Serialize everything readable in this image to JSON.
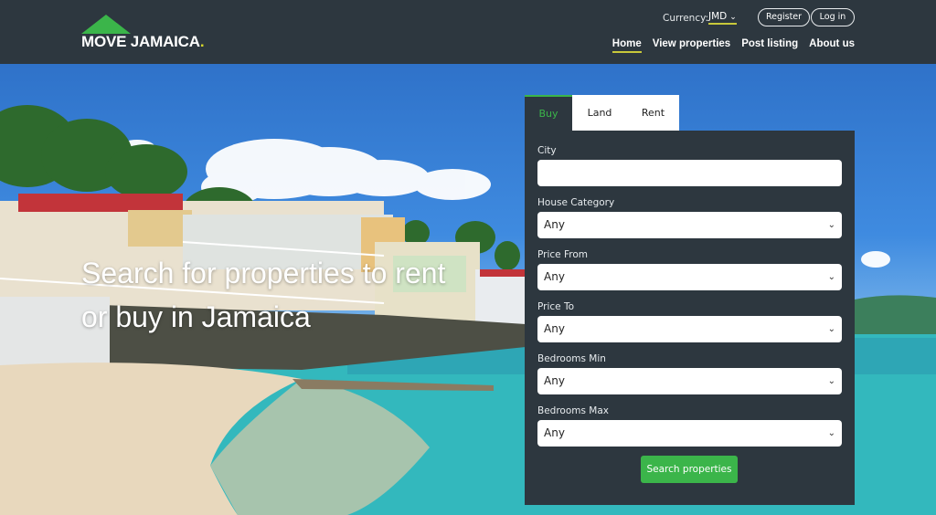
{
  "brand": {
    "name": "MOVE JAMAICA",
    "dot": "."
  },
  "header": {
    "currency_label": "Currency:",
    "currency_value": "JMD",
    "register_label": "Register",
    "login_label": "Log in",
    "nav": [
      {
        "label": "Home",
        "active": true
      },
      {
        "label": "View properties"
      },
      {
        "label": "Post listing"
      },
      {
        "label": "About us"
      }
    ]
  },
  "hero": {
    "heading": "Search for properties to rent or buy in Jamaica"
  },
  "search": {
    "tabs": [
      "Buy",
      "Land",
      "Rent"
    ],
    "active_tab": "Buy",
    "fields": [
      {
        "label": "City",
        "value": ""
      },
      {
        "label": "House Category",
        "value": "Any"
      },
      {
        "label": "Price From",
        "value": "Any"
      },
      {
        "label": "Price To",
        "value": "Any"
      },
      {
        "label": "Bedrooms Min",
        "value": "Any"
      },
      {
        "label": "Bedrooms Max",
        "value": "Any"
      }
    ],
    "submit_label": "Search properties"
  },
  "colors": {
    "header_bg": "#2d373f",
    "accent_green": "#3bb54a",
    "accent_yellow": "#c8c83a"
  },
  "icons": [
    "chevron-down-icon"
  ]
}
